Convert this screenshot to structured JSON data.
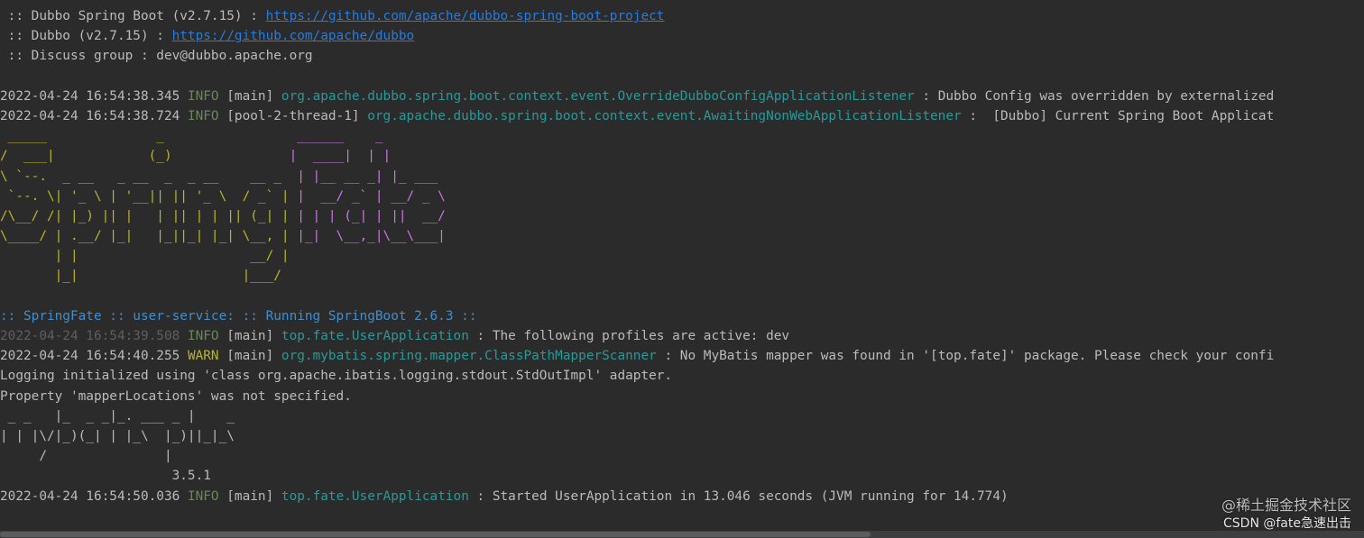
{
  "console": {
    "lines": [
      {
        "segments": [
          {
            "c": "plain",
            "t": " :: Dubbo Spring Boot (v2.7.15) : "
          },
          {
            "c": "link",
            "t": "https://github.com/apache/dubbo-spring-boot-project"
          }
        ]
      },
      {
        "segments": [
          {
            "c": "plain",
            "t": " :: Dubbo (v2.7.15) : "
          },
          {
            "c": "link",
            "t": "https://github.com/apache/dubbo"
          }
        ]
      },
      {
        "segments": [
          {
            "c": "plain",
            "t": " :: Discuss group : dev@dubbo.apache.org"
          }
        ]
      },
      {
        "segments": []
      },
      {
        "segments": [
          {
            "c": "time",
            "t": "2022-04-24 16:54:38.345 "
          },
          {
            "c": "info",
            "t": "INFO "
          },
          {
            "c": "thread",
            "t": "[main] "
          },
          {
            "c": "logger",
            "t": "org.apache.dubbo.spring.boot.context.event.OverrideDubboConfigApplicationListener"
          },
          {
            "c": "plain",
            "t": " : Dubbo Config was overridden by externalized"
          }
        ]
      },
      {
        "segments": [
          {
            "c": "time",
            "t": "2022-04-24 16:54:38.724 "
          },
          {
            "c": "info",
            "t": "INFO "
          },
          {
            "c": "thread",
            "t": "[pool-2-thread-1] "
          },
          {
            "c": "logger",
            "t": "org.apache.dubbo.spring.boot.context.event.AwaitingNonWebApplicationListener"
          },
          {
            "c": "plain",
            "t": " :  [Dubbo] Current Spring Boot Applicat"
          }
        ]
      },
      {
        "segments": [
          {
            "c": "ascii-yellow",
            "t": " _____              _                "
          },
          {
            "c": "ascii-magenta",
            "t": " ______    _"
          }
        ]
      },
      {
        "segments": [
          {
            "c": "ascii-yellow",
            "t": "/  ___|            (_)               "
          },
          {
            "c": "ascii-magenta",
            "t": "|  ____|  | |"
          }
        ]
      },
      {
        "segments": [
          {
            "c": "ascii-yellow",
            "t": "\\ `--.  _ __   _ __  _  _ __    __ _  "
          },
          {
            "c": "ascii-magenta",
            "t": "| |__ __ _| |_ ___"
          }
        ]
      },
      {
        "segments": [
          {
            "c": "ascii-yellow",
            "t": " `--. \\| '_ \\ | '__|| || '_ \\  / _` | "
          },
          {
            "c": "ascii-magenta",
            "t": "|  __/ _` | __/ _ \\"
          }
        ]
      },
      {
        "segments": [
          {
            "c": "ascii-yellow",
            "t": "/\\__/ /| |_) || |   | || | | || (_| | "
          },
          {
            "c": "ascii-magenta",
            "t": "| | | (_| | ||  __/"
          }
        ]
      },
      {
        "segments": [
          {
            "c": "ascii-yellow",
            "t": "\\____/ | .__/ |_|   |_||_| |_| \\__, | "
          },
          {
            "c": "ascii-magenta",
            "t": "|_|  \\__,_|\\__\\___|"
          }
        ]
      },
      {
        "segments": [
          {
            "c": "ascii-yellow",
            "t": "       | |                      __/ |"
          }
        ]
      },
      {
        "segments": [
          {
            "c": "ascii-yellow",
            "t": "       |_|                     |___/"
          }
        ]
      },
      {
        "segments": []
      },
      {
        "segments": [
          {
            "c": "blue",
            "t": ":: SpringFate :: user-service: :: Running SpringBoot 2.6.3 ::"
          }
        ]
      },
      {
        "segments": [
          {
            "c": "time dim",
            "t": "2022-04-24 16:54:39.508 "
          },
          {
            "c": "info",
            "t": "INFO "
          },
          {
            "c": "thread",
            "t": "[main] "
          },
          {
            "c": "logger",
            "t": "top.fate.UserApplication"
          },
          {
            "c": "plain",
            "t": " : The following profiles are active: dev"
          }
        ]
      },
      {
        "segments": [
          {
            "c": "time",
            "t": "2022-04-24 16:54:40.255 "
          },
          {
            "c": "warn",
            "t": "WARN "
          },
          {
            "c": "thread",
            "t": "[main] "
          },
          {
            "c": "logger",
            "t": "org.mybatis.spring.mapper.ClassPathMapperScanner"
          },
          {
            "c": "plain",
            "t": " : No MyBatis mapper was found in '[top.fate]' package. Please check your confi"
          }
        ]
      },
      {
        "segments": [
          {
            "c": "plain",
            "t": "Logging initialized using 'class org.apache.ibatis.logging.stdout.StdOutImpl' adapter."
          }
        ]
      },
      {
        "segments": [
          {
            "c": "plain",
            "t": "Property 'mapperLocations' was not specified."
          }
        ]
      },
      {
        "segments": [
          {
            "c": "plain",
            "t": " _ _   |_  _ _|_. ___ _ |    _"
          }
        ]
      },
      {
        "segments": [
          {
            "c": "plain",
            "t": "| | |\\/|_)(_| | |_\\  |_)||_|_\\"
          }
        ]
      },
      {
        "segments": [
          {
            "c": "plain",
            "t": "     /               |"
          }
        ]
      },
      {
        "segments": [
          {
            "c": "plain",
            "t": "                      3.5.1"
          }
        ]
      },
      {
        "segments": [
          {
            "c": "time",
            "t": "2022-04-24 16:54:50.036 "
          },
          {
            "c": "info",
            "t": "INFO "
          },
          {
            "c": "thread",
            "t": "[main] "
          },
          {
            "c": "logger",
            "t": "top.fate.UserApplication"
          },
          {
            "c": "plain",
            "t": " : Started UserApplication in 13.046 seconds (JVM running for 14.774)"
          }
        ]
      }
    ]
  },
  "watermark": {
    "site": "@稀土掘金技术社区",
    "author": "CSDN @fate急速出击"
  },
  "colors": {
    "background": "#2b2b2b",
    "text": "#bbbbbb",
    "link": "#287bde",
    "info": "#6a8759",
    "warn": "#bbb529",
    "logger": "#299999",
    "banner_blue": "#3d8fd1",
    "ascii_yellow": "#bbb529",
    "ascii_magenta": "#c678dd"
  }
}
